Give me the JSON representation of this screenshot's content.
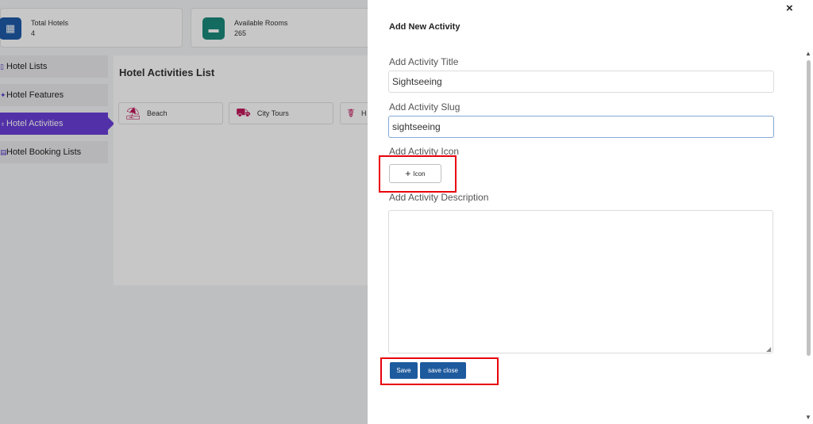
{
  "stats": [
    {
      "label": "Total Hotels",
      "value": "4",
      "icon": "building-icon",
      "color": "#1e5aa8"
    },
    {
      "label": "Available Rooms",
      "value": "265",
      "icon": "bed-icon",
      "color": "#1a8a7a"
    }
  ],
  "sidebar": {
    "items": [
      {
        "label": "Hotel Lists"
      },
      {
        "label": "Hotel Features"
      },
      {
        "label": "Hotel Activities",
        "active": true
      },
      {
        "label": "Hotel Booking Lists"
      }
    ]
  },
  "main": {
    "title": "Hotel Activities List",
    "activities": [
      {
        "label": "Beach",
        "icon": "beach-umbrella-icon"
      },
      {
        "label": "City Tours",
        "icon": "tour-bus-icon"
      },
      {
        "label": "H",
        "icon": "hiking-icon"
      }
    ]
  },
  "drawer": {
    "title": "Add New Activity",
    "close_glyph": "×",
    "title_label": "Add Activity Title",
    "title_value": "Sightseeing",
    "slug_label": "Add Activity Slug",
    "slug_value": "sightseeing",
    "icon_label": "Add Activity Icon",
    "icon_button": "Icon",
    "description_label": "Add Activity Description",
    "description_value": "",
    "save_label": "Save",
    "save_close_label": "save close"
  },
  "colors": {
    "accent": "#6a3fd8",
    "primary_button": "#1e5a9e",
    "highlight_box": "#e8000b",
    "activity_icon": "#c0185a"
  }
}
